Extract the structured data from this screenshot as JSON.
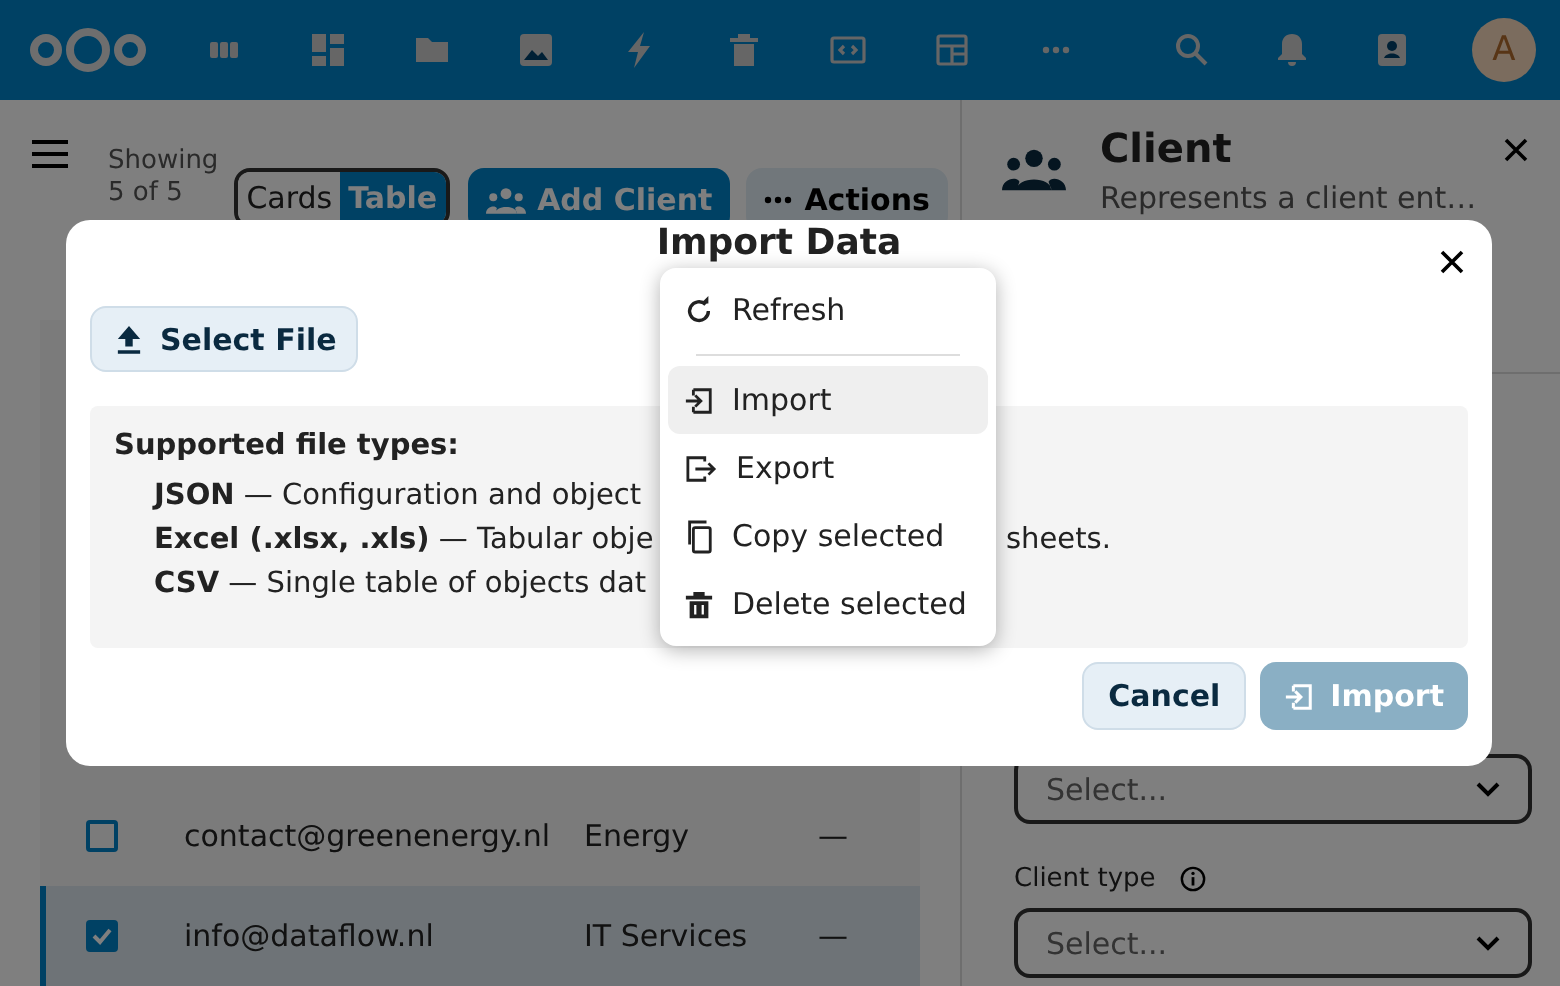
{
  "header": {
    "avatar": "A"
  },
  "toolbar": {
    "count_label": "Showing",
    "count_value": "5 of 5",
    "view_tabs": [
      {
        "label": "Cards",
        "selected": false
      },
      {
        "label": "Table",
        "selected": true
      }
    ],
    "add_button": "Add Client",
    "actions_button": "Actions"
  },
  "table": {
    "rows": [
      {
        "email": "contact@greenenergy.nl",
        "sector": "Energy",
        "column_4": "—",
        "checked": false,
        "selected": false
      },
      {
        "email": "info@dataflow.nl",
        "sector": "IT Services",
        "column_4": "—",
        "checked": true,
        "selected": true
      }
    ]
  },
  "sidebar": {
    "title": "Client",
    "subtitle": "Represents a client ent…",
    "fields": [
      {
        "placeholder": "Select..."
      },
      {
        "label": "Client type",
        "placeholder": "Select..."
      }
    ]
  },
  "dialog": {
    "title": "Import Data",
    "select_button": "Select File",
    "info_title": "Supported file types:",
    "file_types": [
      {
        "text": "**JSON** — Configuration and object"
      },
      {
        "text": "**Excel (.xlsx, .xls)** — Tabular obje",
        "tail": "sheets."
      },
      {
        "text": "**CSV** — Single table of objects dat"
      }
    ],
    "cancel_button": "Cancel",
    "import_button": {
      "label": "Import",
      "disabled": true
    }
  },
  "menu": {
    "items": [
      {
        "kind": "item",
        "label": "Refresh",
        "highlighted": false
      },
      {
        "kind": "separator"
      },
      {
        "kind": "item",
        "label": "Import",
        "highlighted": true
      },
      {
        "kind": "item",
        "label": "Export",
        "highlighted": false
      },
      {
        "kind": "item",
        "label": "Copy selected",
        "highlighted": false
      },
      {
        "kind": "item",
        "label": "Delete selected",
        "highlighted": false
      }
    ]
  }
}
